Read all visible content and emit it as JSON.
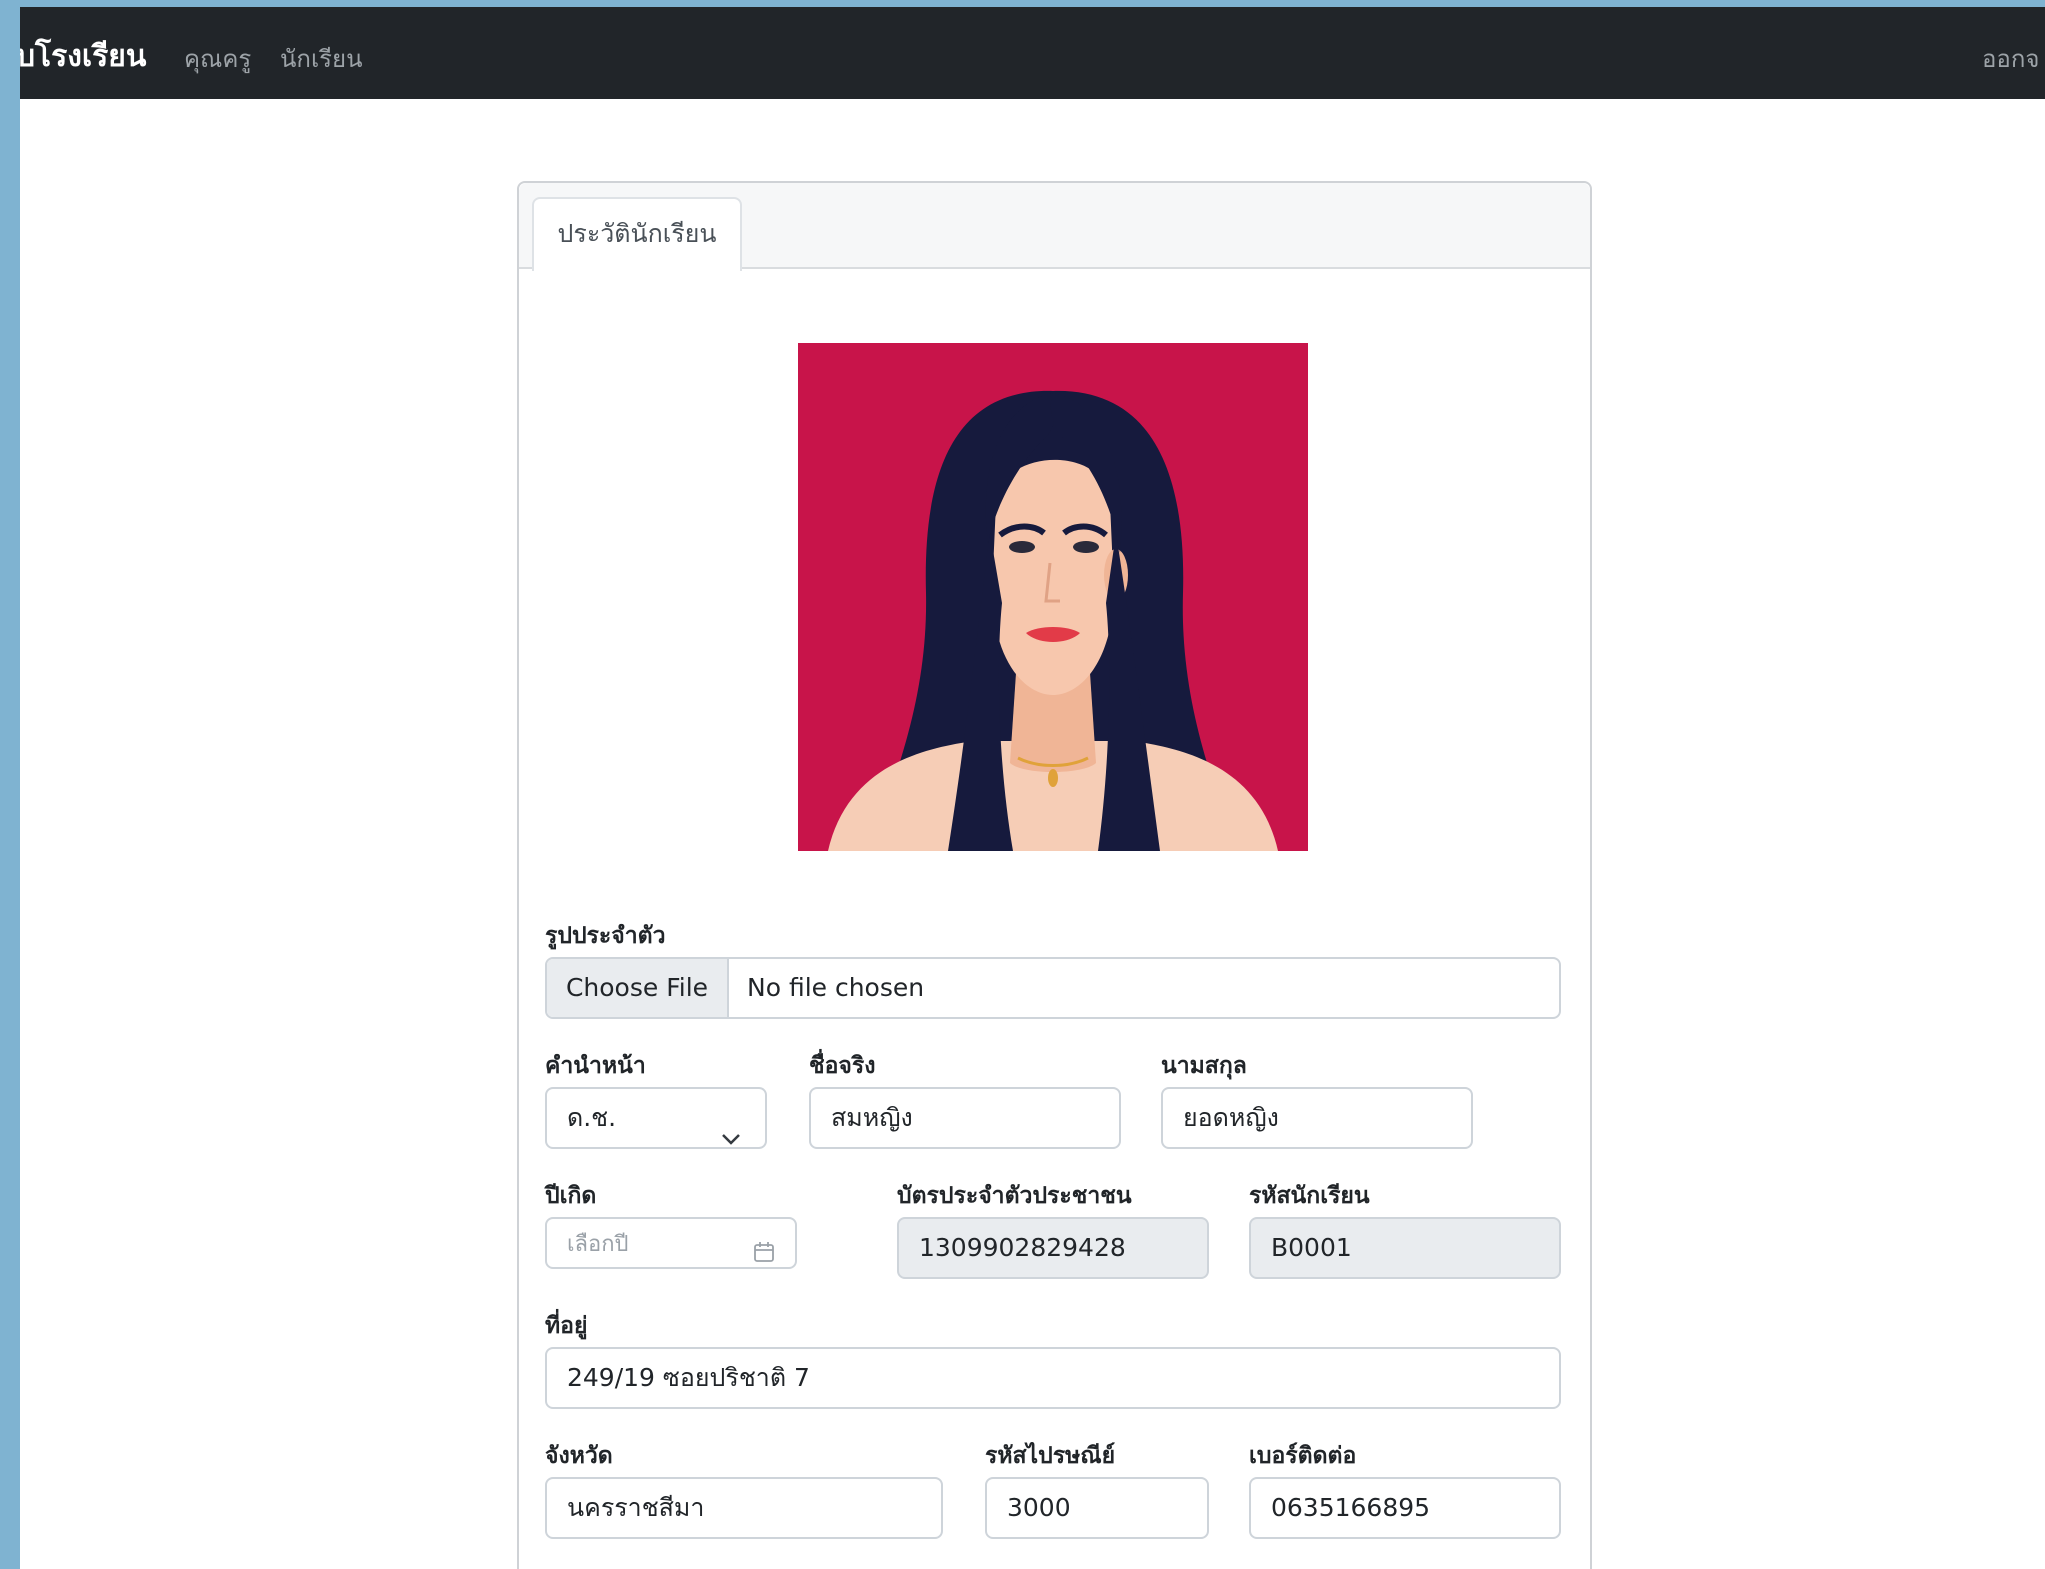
{
  "navbar": {
    "brand": "บโรงเรียน",
    "links": [
      "คุณครู",
      "นักเรียน"
    ],
    "logout": "ออกจ"
  },
  "tab": {
    "label": "ประวัตินักเรียน"
  },
  "form": {
    "photo": {
      "label": "รูปประจำตัว",
      "button": "Choose File",
      "status": "No file chosen"
    },
    "prefix": {
      "label": "คำนำหน้า",
      "value": "ด.ช."
    },
    "firstname": {
      "label": "ชื่อจริง",
      "value": "สมหญิง"
    },
    "lastname": {
      "label": "นามสกุล",
      "value": "ยอดหญิง"
    },
    "birthyear": {
      "label": "ปีเกิด",
      "placeholder": "เลือกปี"
    },
    "idcard": {
      "label": "บัตรประจำตัวประชาชน",
      "value": "1309902829428"
    },
    "studentid": {
      "label": "รหัสนักเรียน",
      "value": "B0001"
    },
    "address": {
      "label": "ที่อยู่",
      "value": "249/19 ซอยปริชาติ 7"
    },
    "province": {
      "label": "จังหวัด",
      "value": "นครราชสีมา"
    },
    "postcode": {
      "label": "รหัสไปรษณีย์",
      "value": "3000"
    },
    "phone": {
      "label": "เบอร์ติดต่อ",
      "value": "0635166895"
    }
  },
  "colors": {
    "navbar": "#212529",
    "outer_frame": "#7fb3d1",
    "avatar_background": "#c8144a",
    "readonly_field": "#e9ecef"
  },
  "icons": [
    "chevron-down-icon",
    "calendar-icon"
  ]
}
